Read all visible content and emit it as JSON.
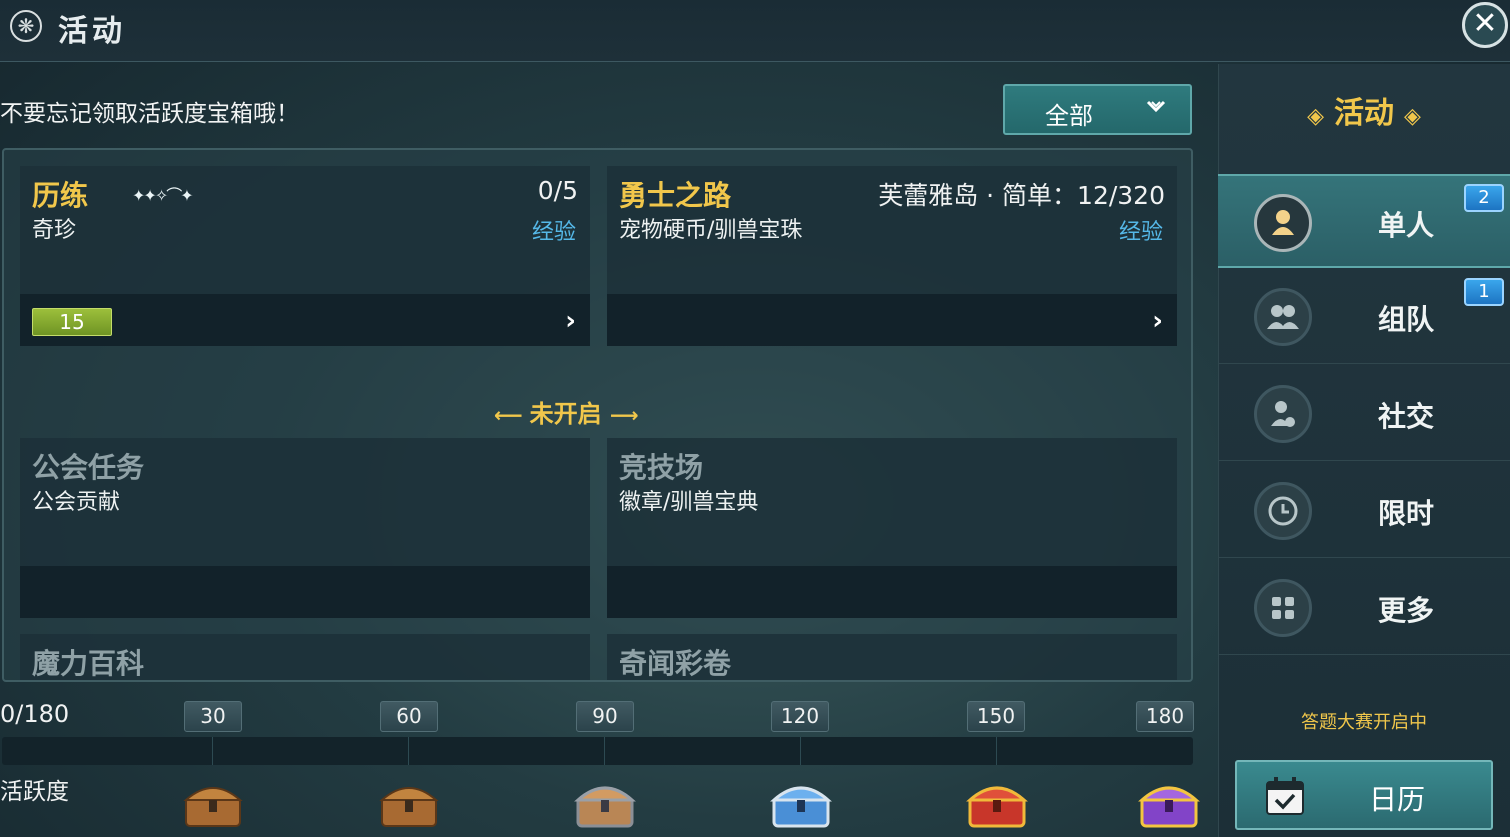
{
  "header": {
    "title": "活动",
    "icon": "gear-icon",
    "close": "✕"
  },
  "reminder": "不要忘记领取活跃度宝箱哦！",
  "filter": {
    "value": "全部",
    "arrow": "⌄"
  },
  "cards_active": [
    {
      "name": "历练",
      "sub": "奇珍",
      "progress": "0/5",
      "reward": "经验",
      "level": "15",
      "arrow": "›"
    },
    {
      "name": "勇士之路",
      "sub": "宠物硬币/驯兽宝珠",
      "progress": "芙蕾雅岛 · 简单：12/320",
      "reward": "经验",
      "arrow": "›"
    }
  ],
  "section_not_open": "未开启",
  "cards_locked": [
    {
      "name": "公会任务",
      "sub": "公会贡献"
    },
    {
      "name": "竞技场",
      "sub": "徽章/驯兽宝典"
    },
    {
      "name": "魔力百科"
    },
    {
      "name": "奇闻彩卷"
    }
  ],
  "activity": {
    "count": "0/180",
    "label": "活跃度",
    "current": 0,
    "max": 180,
    "milestones": [
      "30",
      "60",
      "90",
      "120",
      "150",
      "180"
    ],
    "chests": [
      {
        "icon": "wooden-chest-icon",
        "color": "#b87a3e"
      },
      {
        "icon": "wooden-chest-icon",
        "color": "#b87a3e"
      },
      {
        "icon": "silver-chest-icon",
        "color": "#c09060"
      },
      {
        "icon": "blue-chest-icon",
        "color": "#5aa6e6"
      },
      {
        "icon": "red-chest-icon",
        "color": "#d0402c"
      },
      {
        "icon": "purple-chest-icon",
        "color": "#8c4ccf"
      }
    ]
  },
  "sidebar": {
    "title": "活动",
    "tabs": [
      {
        "label": "单人",
        "icon": "person-icon",
        "badge": "2",
        "active": true
      },
      {
        "label": "组队",
        "icon": "group-icon",
        "badge": "1",
        "active": false
      },
      {
        "label": "社交",
        "icon": "social-icon",
        "badge": "",
        "active": false
      },
      {
        "label": "限时",
        "icon": "clock-icon",
        "badge": "",
        "active": false
      },
      {
        "label": "更多",
        "icon": "grid-icon",
        "badge": "",
        "active": false
      }
    ],
    "notice": "答题大赛开启中",
    "calendar": "日历"
  },
  "colors": {
    "accent_gold": "#f1c74b",
    "reward_blue": "#55b8e8",
    "level_green": "#8db338",
    "badge_blue": "#2a8ad8"
  }
}
